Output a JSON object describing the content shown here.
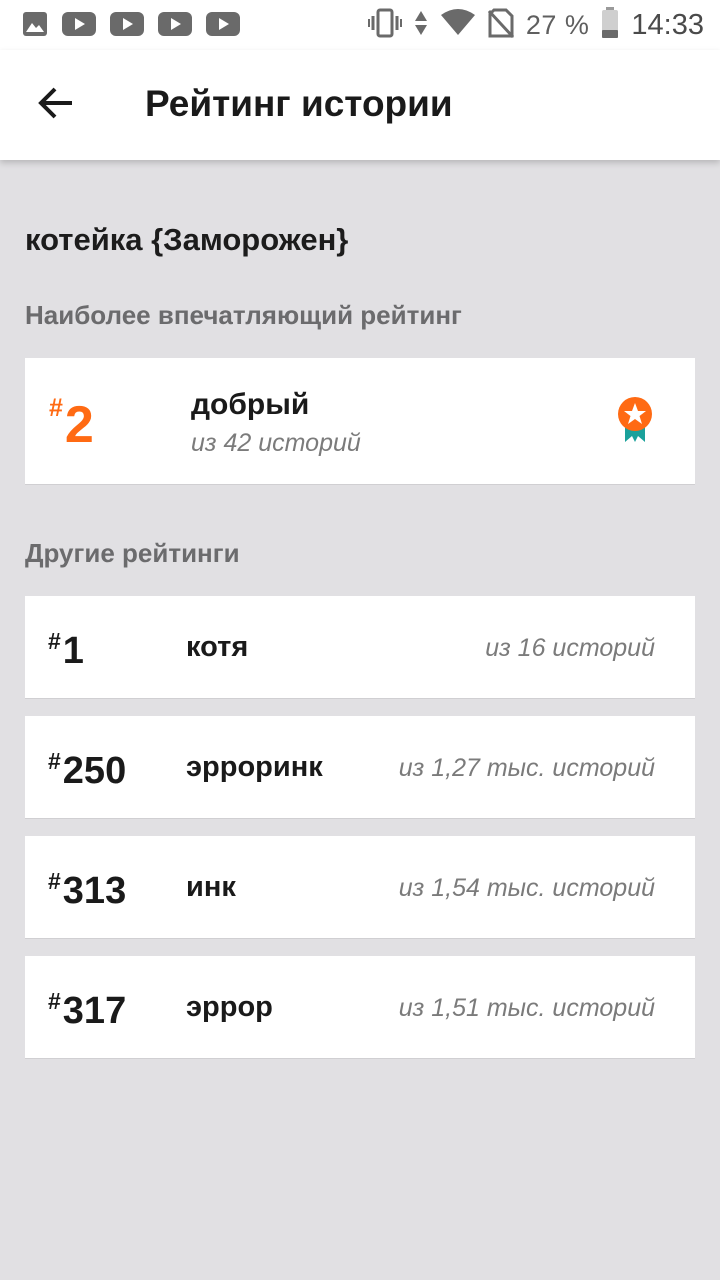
{
  "status_bar": {
    "notification_icons": [
      "image-icon",
      "youtube-icon",
      "youtube-icon",
      "youtube-icon",
      "youtube-icon"
    ],
    "battery_percent": "27 %",
    "time": "14:33",
    "icons": [
      "vibrate-icon",
      "data-arrows-icon",
      "wifi-icon",
      "no-sim-icon",
      "battery-icon"
    ]
  },
  "app_bar": {
    "title": "Рейтинг истории",
    "back_icon": "arrow-back-icon"
  },
  "story": {
    "title": "котейка {Заморожен}"
  },
  "top_section": {
    "label": "Наиболее впечатляющий рейтинг",
    "item": {
      "hash": "#",
      "rank": "2",
      "tag": "добрый",
      "count": "из 42 историй",
      "badge_icon": "award-ribbon-icon"
    }
  },
  "other_section": {
    "label": "Другие рейтинги",
    "items": [
      {
        "hash": "#",
        "rank": "1",
        "tag": "котя",
        "count": "из 16 историй"
      },
      {
        "hash": "#",
        "rank": "250",
        "tag": "эрроринк",
        "count": "из 1,27 тыс. историй"
      },
      {
        "hash": "#",
        "rank": "313",
        "tag": "инк",
        "count": "из 1,54 тыс. историй"
      },
      {
        "hash": "#",
        "rank": "317",
        "tag": "эррор",
        "count": "из 1,51 тыс. историй"
      }
    ]
  },
  "colors": {
    "accent": "#ff6a13",
    "teal": "#1aa19b",
    "background": "#e1e0e3"
  }
}
